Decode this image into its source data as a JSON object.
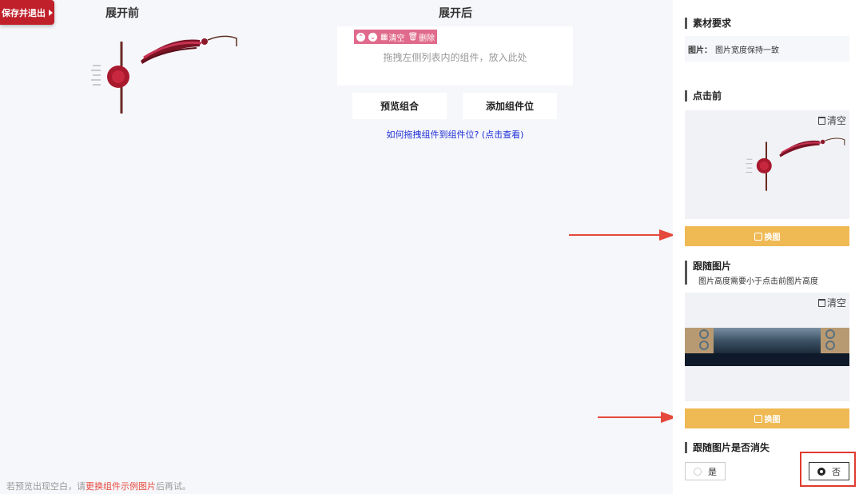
{
  "toolbar": {
    "save_label": "保存并退出"
  },
  "canvas": {
    "before_title": "展开前",
    "after_title": "展开后",
    "drop_tools": {
      "clear_label": "清空",
      "delete_label": "删除"
    },
    "drop_hint": "拖拽左侧列表内的组件，放入此处",
    "preview_label": "预览组合",
    "add_label": "添加组件位",
    "help_link": "如何拖拽组件到组件位? (点击查看)"
  },
  "bottom_note": {
    "prefix": "若预览出现空白，请",
    "link": "更换组件示例图片",
    "suffix": "后再试。"
  },
  "panel": {
    "material_title": "素材要求",
    "material_key": "图片：",
    "material_value": "图片宽度保持一致",
    "before_click_title": "点击前",
    "clear_label": "清空",
    "swap_label": "换图",
    "follow_title": "跟随图片",
    "follow_note": "图片高度需要小于点击前图片高度",
    "disappear_title": "跟随图片是否消失",
    "options": [
      {
        "label": "是",
        "selected": false
      },
      {
        "label": "否",
        "selected": true
      }
    ]
  },
  "colors": {
    "accent_red": "#c0202a",
    "swap_yellow": "#efb953",
    "toolbar_pink": "#e06a8b",
    "link_blue": "#1e2fd6",
    "arrow_red": "#e5483c"
  }
}
